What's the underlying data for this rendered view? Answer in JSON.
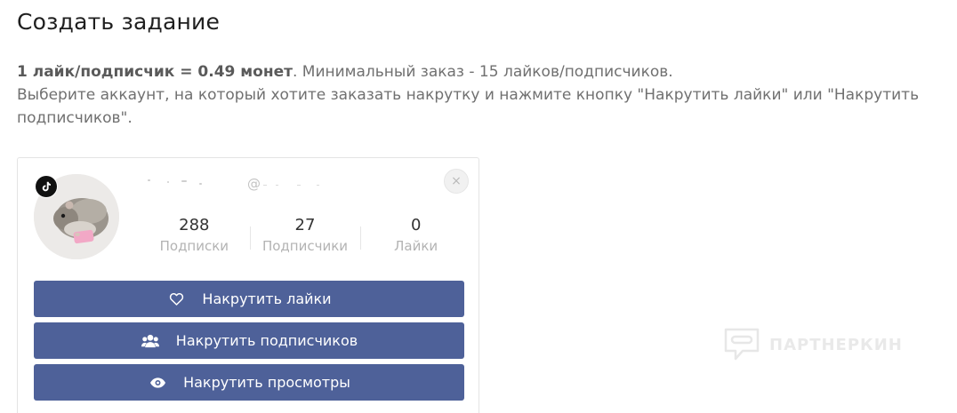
{
  "page": {
    "title": "Создать задание"
  },
  "intro": {
    "rate_bold": "1 лайк/подписчик = 0.49 монет",
    "rate_rest": ". Минимальный заказ - 15 лайков/подписчиков.",
    "instruction_line1": "Выберите аккаунт, на который хотите заказать накрутку и нажмите кнопку \"Накрутить лайки\" или \"Накрутить",
    "instruction_line2": "подписчиков\"."
  },
  "account_card": {
    "platform_icon": "tiktok-icon",
    "handle_prefix": "@",
    "close_label": "×",
    "stats": [
      {
        "key": "following",
        "value": "288",
        "label": "Подписки"
      },
      {
        "key": "followers",
        "value": "27",
        "label": "Подписчики"
      },
      {
        "key": "likes",
        "value": "0",
        "label": "Лайки"
      }
    ],
    "actions": [
      {
        "key": "likes",
        "label": "Накрутить лайки",
        "icon": "heart-icon"
      },
      {
        "key": "followers",
        "label": "Накрутить подписчиков",
        "icon": "users-icon"
      },
      {
        "key": "views",
        "label": "Накрутить просмотры",
        "icon": "eye-icon"
      }
    ]
  },
  "watermark": {
    "text": "ПАРТНЕРКИН"
  },
  "colors": {
    "button_bg": "#4e6199",
    "intro_text": "#707070",
    "stat_label": "#b3b3b3",
    "watermark": "#e9e9e9"
  }
}
